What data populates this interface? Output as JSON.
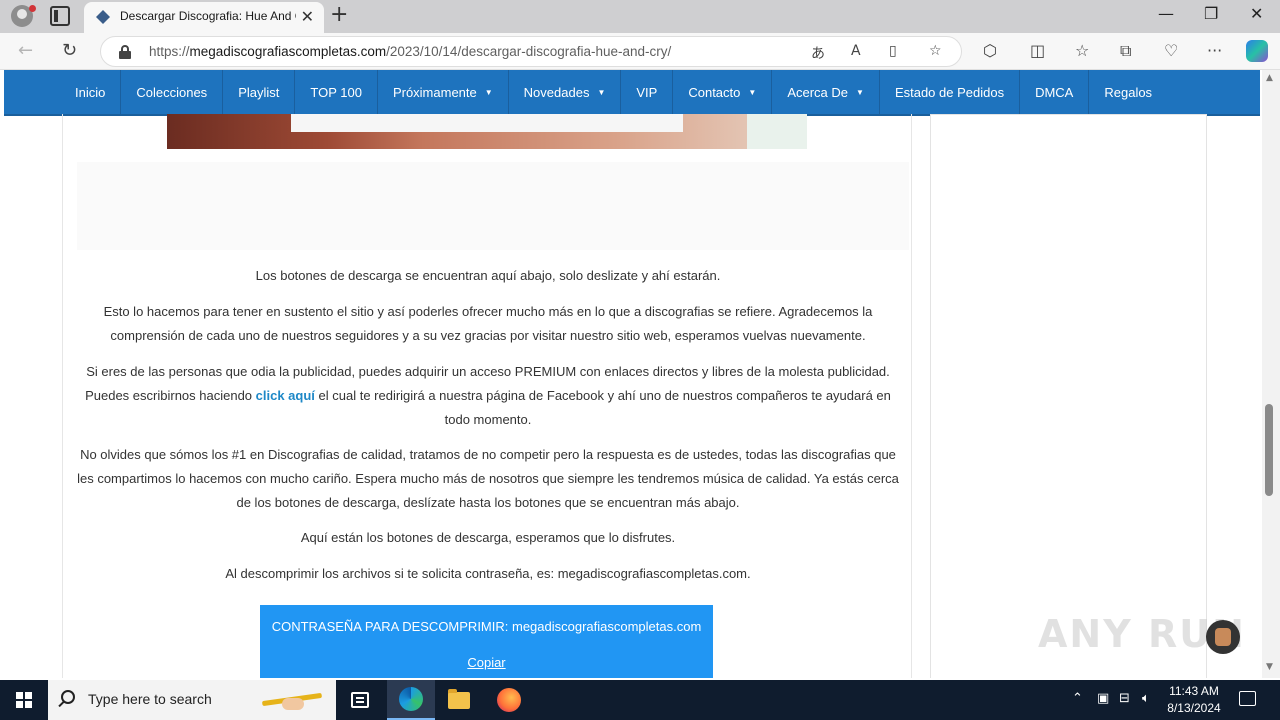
{
  "browser": {
    "tab_title": "Descargar Discografia: Hue And Cry",
    "url_prefix": "https://",
    "url_host": "megadiscografiascompletas.com",
    "url_path": "/2023/10/14/descargar-discografia-hue-and-cry/"
  },
  "site_nav": {
    "items": [
      {
        "label": "Inicio",
        "dropdown": false
      },
      {
        "label": "Colecciones",
        "dropdown": false
      },
      {
        "label": "Playlist",
        "dropdown": false
      },
      {
        "label": "TOP 100",
        "dropdown": false
      },
      {
        "label": "Próximamente",
        "dropdown": true
      },
      {
        "label": "Novedades",
        "dropdown": true
      },
      {
        "label": "VIP",
        "dropdown": false
      },
      {
        "label": "Contacto",
        "dropdown": true
      },
      {
        "label": "Acerca De",
        "dropdown": true
      },
      {
        "label": "Estado de Pedidos",
        "dropdown": false
      },
      {
        "label": "DMCA",
        "dropdown": false
      },
      {
        "label": "Regalos",
        "dropdown": false
      }
    ]
  },
  "content": {
    "p1": "Los botones de descarga se encuentran aquí abajo, solo deslizate y ahí estarán.",
    "p2": "Esto lo hacemos para tener en sustento el sitio y así poderles ofrecer mucho más en lo que a discografias se refiere. Agradecemos la comprensión de cada uno de nuestros seguidores y a su vez gracias por visitar nuestro sitio web, esperamos vuelvas nuevamente.",
    "p3_before": "Si eres de las personas que odia la publicidad, puedes adquirir un acceso PREMIUM con enlaces directos y libres de la molesta publicidad. Puedes escribirnos haciendo ",
    "p3_link": "click aquí",
    "p3_after": " el cual te redirigirá a nuestra página de Facebook y ahí uno de nuestros compañeros te ayudará en todo momento.",
    "p4": "No olvides que sómos los #1 en Discografias de calidad, tratamos de no competir pero la respuesta es de ustedes, todas las discografias que les compartimos lo hacemos con mucho cariño. Espera mucho más de nosotros que siempre les tendremos música de calidad. Ya estás cerca de los botones de descarga, deslízate hasta los botones que se encuentran más abajo.",
    "p5": "Aquí están los botones de descarga, esperamos que lo disfrutes.",
    "p6": "Al descomprimir los archivos si te solicita contraseña, es: megadiscografiascompletas.com.",
    "password_label": "CONTRASEÑA PARA DESCOMPRIMIR: megadiscografiascompletas.com",
    "copy_label": "Copiar"
  },
  "watermark": "ANY RUN",
  "taskbar": {
    "search_placeholder": "Type here to search",
    "time": "11:43 AM",
    "date": "8/13/2024"
  },
  "colors": {
    "nav_blue": "#1e73be",
    "password_box": "#2196f3",
    "link": "#1e88c7"
  }
}
